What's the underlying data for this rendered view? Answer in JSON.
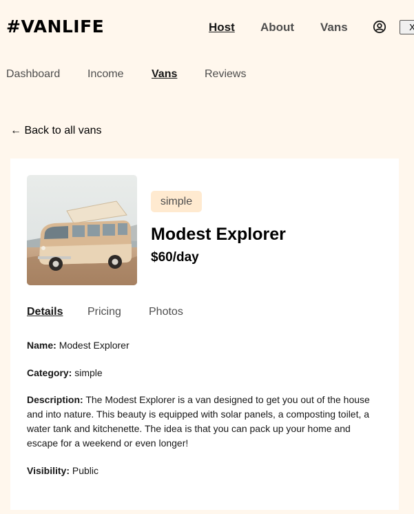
{
  "header": {
    "logo": "#VANLIFE",
    "nav": {
      "host": "Host",
      "about": "About",
      "vans": "Vans"
    },
    "close_label": "X"
  },
  "subnav": {
    "dashboard": "Dashboard",
    "income": "Income",
    "vans": "Vans",
    "reviews": "Reviews"
  },
  "back_link": "← Back to all vans",
  "van": {
    "type": "simple",
    "name": "Modest Explorer",
    "price": "$60/day"
  },
  "tabs": {
    "details": "Details",
    "pricing": "Pricing",
    "photos": "Photos"
  },
  "details": {
    "name_label": "Name:",
    "name_value": "Modest Explorer",
    "category_label": "Category:",
    "category_value": "simple",
    "description_label": "Description:",
    "description_value": "The Modest Explorer is a van designed to get you out of the house and into nature. This beauty is equipped with solar panels, a composting toilet, a water tank and kitchenette. The idea is that you can pack up your home and escape for a weekend or even longer!",
    "visibility_label": "Visibility:",
    "visibility_value": "Public"
  },
  "colors": {
    "background": "#FFF7ED",
    "badge_bg": "#FFEAD0",
    "card_bg": "#FFFFFF"
  },
  "icons": {
    "user": "user-circle-icon"
  }
}
